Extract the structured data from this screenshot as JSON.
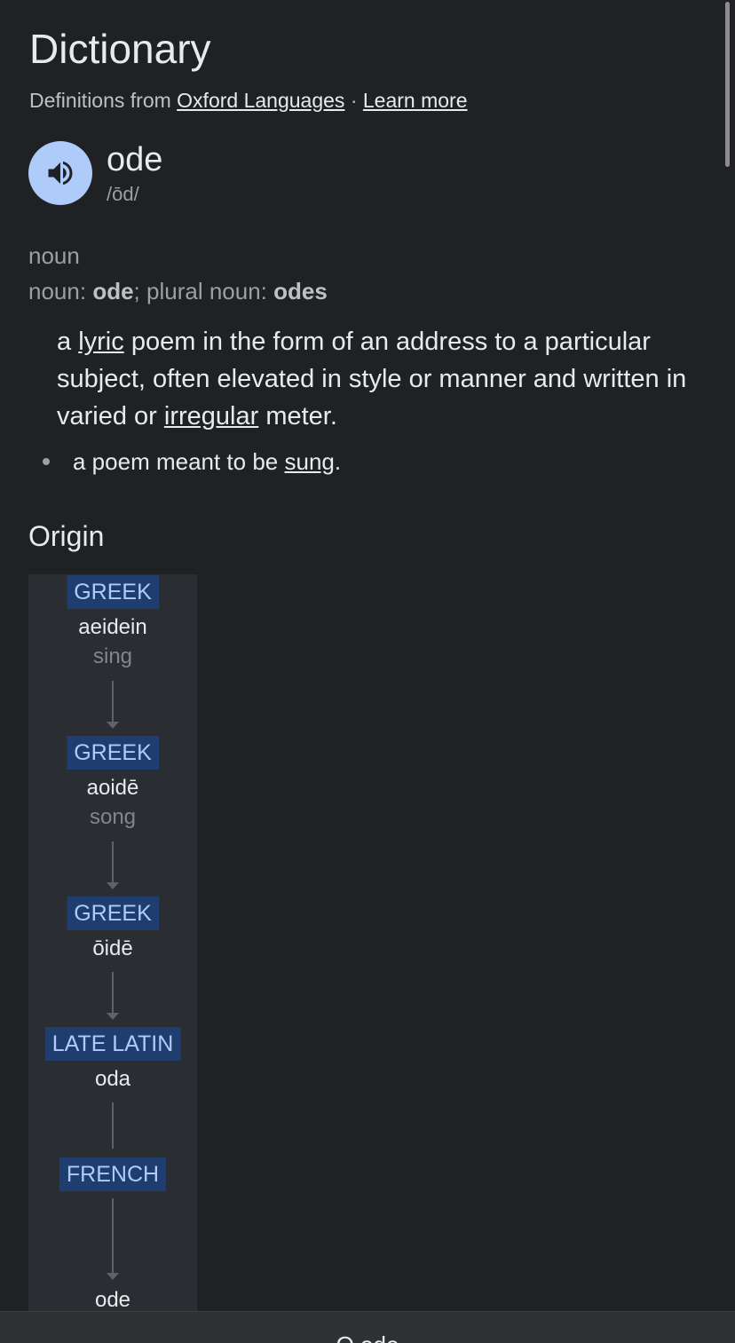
{
  "header": {
    "title": "Dictionary",
    "source_prefix": "Definitions from",
    "source_link": "Oxford Languages",
    "separator": "·",
    "learn_more": "Learn more"
  },
  "entry": {
    "word": "ode",
    "pronunciation": "/ōd/",
    "audio_icon": "speaker-icon",
    "part_of_speech": "noun",
    "forms": {
      "noun_label": "noun:",
      "noun_value": "ode",
      "sep": ";",
      "plural_label": "plural noun:",
      "plural_value": "odes"
    },
    "definition": {
      "p1": "a",
      "link1": "lyric",
      "p2": "poem in the form of an address to a particular subject, often elevated in style or manner and written in varied or",
      "link2": "irregular",
      "p3": "meter."
    },
    "subdefinition": {
      "p1": "a poem meant to be",
      "link1": "sung",
      "p2": "."
    }
  },
  "origin": {
    "heading": "Origin",
    "steps": [
      {
        "lang": "GREEK",
        "word": "aeidein",
        "gloss": "sing"
      },
      {
        "lang": "GREEK",
        "word": "aoidē",
        "gloss": "song"
      },
      {
        "lang": "GREEK",
        "word": "ōidē",
        "gloss": ""
      },
      {
        "lang": "LATE LATIN",
        "word": "oda",
        "gloss": ""
      },
      {
        "lang": "FRENCH",
        "word": "",
        "gloss": ""
      },
      {
        "lang": "",
        "word": "ode",
        "gloss": ""
      }
    ]
  },
  "bottom_bar": {
    "label": "O ode"
  },
  "colors": {
    "background": "#202124",
    "audio_button": "#aecbfa",
    "lang_chip_bg": "#1f3d6e",
    "lang_chip_text": "#aecbfa",
    "panel_bg": "#2a2e33"
  }
}
